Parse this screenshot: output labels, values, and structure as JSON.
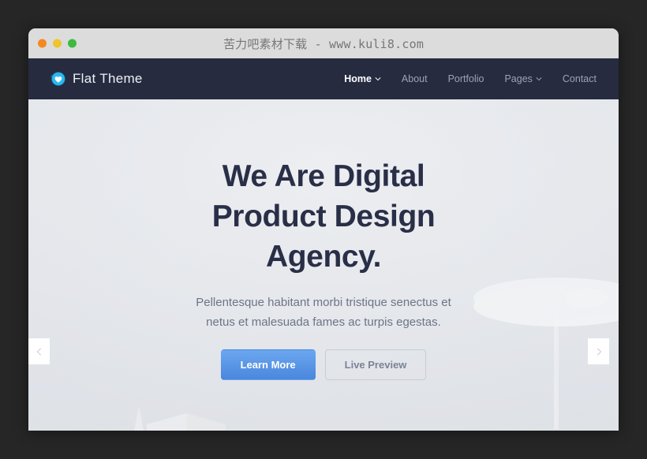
{
  "window": {
    "title": "苦力吧素材下载 - www.kuli8.com",
    "controls": {
      "close_label": "close",
      "minimize_label": "minimize",
      "maximize_label": "maximize"
    }
  },
  "navbar": {
    "brand": {
      "name": "Flat Theme",
      "icon": "shield-heart-icon"
    },
    "items": [
      {
        "label": "Home",
        "has_chevron": true,
        "active": true
      },
      {
        "label": "About",
        "has_chevron": false,
        "active": false
      },
      {
        "label": "Portfolio",
        "has_chevron": false,
        "active": false
      },
      {
        "label": "Pages",
        "has_chevron": true,
        "active": false
      },
      {
        "label": "Contact",
        "has_chevron": false,
        "active": false
      }
    ]
  },
  "hero": {
    "title_line_1": "We Are Digital",
    "title_line_2": "Product Design",
    "title_line_3": "Agency.",
    "subtitle": "Pellentesque habitant morbi tristique senectus et netus et malesuada fames ac turpis egestas.",
    "primary_button": "Learn More",
    "secondary_button": "Live Preview",
    "carousel_prev_icon": "chevron-left-icon",
    "carousel_next_icon": "chevron-right-icon"
  },
  "colors": {
    "desktop_background": "#262626",
    "titlebar": "#dcdcdc",
    "titlebar_text": "#767676",
    "navbar": "#262b40",
    "nav_link": "#9ba3b8",
    "nav_link_active": "#ffffff",
    "hero_background": "#e8eaed",
    "heading": "#2a2f48",
    "body_text": "#6c7586",
    "primary_button": "#4a86dd",
    "traffic_close": "#f5881f",
    "traffic_minimize": "#efc52e",
    "traffic_maximize": "#3dbb3d",
    "brand_icon": "#2bb8ef"
  }
}
